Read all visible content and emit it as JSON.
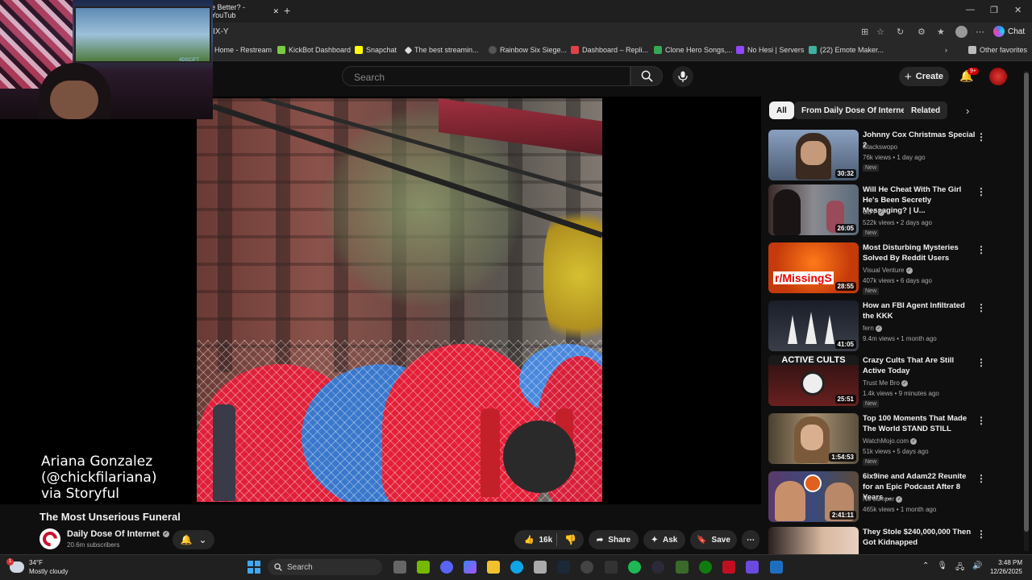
{
  "browser": {
    "tab_title": "e Better? - YouTub",
    "url": "IX-Y",
    "chat_label": "Chat",
    "bookmarks": [
      "Home - Restream",
      "KickBot Dashboard",
      "Snapchat",
      "The best streamin...",
      "Rainbow Six Siege...",
      "Dashboard – Repli...",
      "Clone Hero Songs,...",
      "No Hesi | Servers",
      "(22) Emote Maker..."
    ],
    "other_favorites": "Other favorites"
  },
  "youtube": {
    "search_placeholder": "Search",
    "create_label": "Create",
    "notif_badge": "9+"
  },
  "webcam": {
    "overlay_text": "4DSCIFT"
  },
  "video": {
    "caption_line1": "Ariana Gonzalez",
    "caption_line2": "(@chickfilariana)",
    "caption_line3": "via Storyful",
    "title": "The Most Unserious Funeral",
    "channel_name": "Daily Dose Of Internet",
    "subscribers": "20.6m subscribers",
    "like_count": "16k",
    "share_label": "Share",
    "ask_label": "Ask",
    "save_label": "Save"
  },
  "chips": [
    "All",
    "From Daily Dose Of Internet",
    "Related"
  ],
  "recommendations": [
    {
      "title": "Johnny Cox Christmas Special 2",
      "channel": "Stackswopo",
      "verified": false,
      "stats": "76k views • 1 day ago",
      "new": "New",
      "duration": "30:32",
      "thumb_color": "#6a7d95"
    },
    {
      "title": "Will He Cheat With The Girl He's Been Secretly Messaging? | U...",
      "channel": "UDY",
      "verified": true,
      "stats": "522k views • 2 days ago",
      "new": "New",
      "duration": "26:05",
      "thumb_color": "#8e7c72"
    },
    {
      "title": "Most Disturbing Mysteries Solved By Reddit Users",
      "channel": "Visual Venture",
      "verified": true,
      "stats": "407k views • 6 days ago",
      "new": "New",
      "duration": "28:55",
      "thumb_color": "#e5521a",
      "thumb_text": "r/MissingS"
    },
    {
      "title": "How an FBI Agent Infiltrated the KKK",
      "channel": "fern",
      "verified": true,
      "stats": "9.4m views • 1 month ago",
      "new": "",
      "duration": "41:05",
      "thumb_color": "#2a2e38"
    },
    {
      "title": "Crazy Cults That Are Still Active Today",
      "channel": "Trust Me Bro",
      "verified": true,
      "stats": "1.4k views • 9 minutes ago",
      "new": "New",
      "duration": "25:51",
      "thumb_color": "#5a1a1a",
      "thumb_text": "ACTIVE CULTS"
    },
    {
      "title": "Top 100 Moments That Made The World STAND STILL",
      "channel": "WatchMojo.com",
      "verified": true,
      "stats": "51k views • 5 days ago",
      "new": "New",
      "duration": "1:54:53",
      "thumb_color": "#8a7a60"
    },
    {
      "title": "6ix9ine and Adam22 Reunite for an Epic Podcast After 8 Years ...",
      "channel": "No Jumper",
      "verified": true,
      "stats": "465k views • 1 month ago",
      "new": "",
      "duration": "2:41:11",
      "thumb_color": "#404a6a"
    },
    {
      "title": "They Stole $240,000,000 Then Got Kidnapped",
      "channel": "",
      "verified": false,
      "stats": "",
      "new": "",
      "duration": "",
      "thumb_color": "#b89a80"
    }
  ],
  "taskbar": {
    "temperature": "34°F",
    "weather": "Mostly cloudy",
    "weather_badge": "1",
    "search_label": "Search",
    "time": "3:48 PM",
    "date": "12/26/2025"
  },
  "colors": {
    "accent_red": "#cc0000",
    "bg": "#0f0f0f",
    "chip_bg": "#272727"
  }
}
